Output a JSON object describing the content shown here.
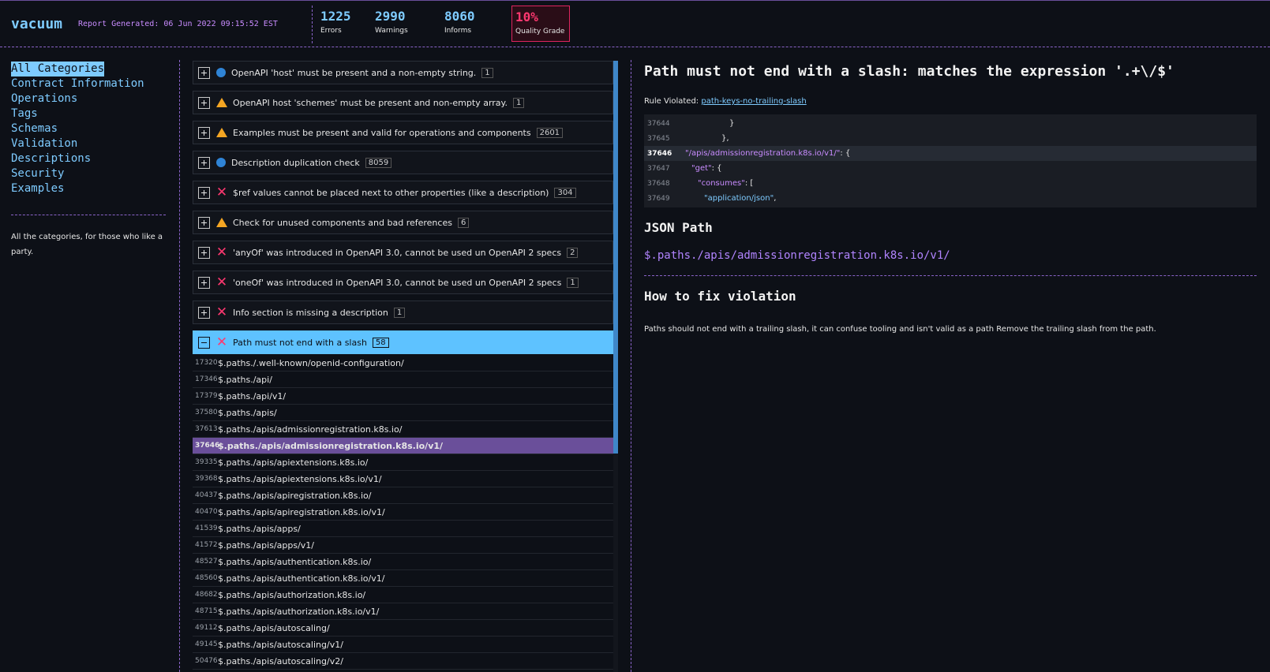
{
  "header": {
    "brand": "vacuum",
    "generated": "Report Generated: 06 Jun 2022 09:15:52 EST",
    "stats": [
      {
        "value": "1225",
        "label": "Errors"
      },
      {
        "value": "2990",
        "label": "Warnings"
      },
      {
        "value": "8060",
        "label": "Informs"
      }
    ],
    "grade": {
      "value": "10%",
      "label": "Quality Grade"
    }
  },
  "sidebar": {
    "items": [
      {
        "label": "All Categories"
      },
      {
        "label": "Contract Information"
      },
      {
        "label": "Operations"
      },
      {
        "label": "Tags"
      },
      {
        "label": "Schemas"
      },
      {
        "label": "Validation"
      },
      {
        "label": "Descriptions"
      },
      {
        "label": "Security"
      },
      {
        "label": "Examples"
      }
    ],
    "description": "All the categories, for those who like a party."
  },
  "rules": [
    {
      "icon": "info-icon",
      "text": "OpenAPI 'host' must be present and a non-empty string.",
      "count": "1"
    },
    {
      "icon": "warning-icon",
      "text": "OpenAPI host 'schemes' must be present and non-empty array.",
      "count": "1"
    },
    {
      "icon": "warning-icon",
      "text": "Examples must be present and valid for operations and components",
      "count": "2601"
    },
    {
      "icon": "info-icon",
      "text": "Description duplication check",
      "count": "8059"
    },
    {
      "icon": "error-icon",
      "text": "$ref values cannot be placed next to other properties (like a description)",
      "count": "304"
    },
    {
      "icon": "warning-icon",
      "text": "Check for unused components and bad references",
      "count": "6"
    },
    {
      "icon": "error-icon",
      "text": "'anyOf' was introduced in OpenAPI 3.0, cannot be used un OpenAPI 2 specs",
      "count": "2"
    },
    {
      "icon": "error-icon",
      "text": "'oneOf' was introduced in OpenAPI 3.0, cannot be used un OpenAPI 2 specs",
      "count": "1"
    },
    {
      "icon": "error-icon",
      "text": "Info section is missing a description",
      "count": "1"
    },
    {
      "icon": "error-icon",
      "text": "Path must not end with a slash",
      "count": "58"
    }
  ],
  "results": [
    {
      "line": "17320",
      "path": "$.paths./.well-known/openid-configuration/"
    },
    {
      "line": "17346",
      "path": "$.paths./api/"
    },
    {
      "line": "17379",
      "path": "$.paths./api/v1/"
    },
    {
      "line": "37580",
      "path": "$.paths./apis/"
    },
    {
      "line": "37613",
      "path": "$.paths./apis/admissionregistration.k8s.io/"
    },
    {
      "line": "37646",
      "path": "$.paths./apis/admissionregistration.k8s.io/v1/"
    },
    {
      "line": "39335",
      "path": "$.paths./apis/apiextensions.k8s.io/"
    },
    {
      "line": "39368",
      "path": "$.paths./apis/apiextensions.k8s.io/v1/"
    },
    {
      "line": "40437",
      "path": "$.paths./apis/apiregistration.k8s.io/"
    },
    {
      "line": "40470",
      "path": "$.paths./apis/apiregistration.k8s.io/v1/"
    },
    {
      "line": "41539",
      "path": "$.paths./apis/apps/"
    },
    {
      "line": "41572",
      "path": "$.paths./apis/apps/v1/"
    },
    {
      "line": "48527",
      "path": "$.paths./apis/authentication.k8s.io/"
    },
    {
      "line": "48560",
      "path": "$.paths./apis/authentication.k8s.io/v1/"
    },
    {
      "line": "48682",
      "path": "$.paths./apis/authorization.k8s.io/"
    },
    {
      "line": "48715",
      "path": "$.paths./apis/authorization.k8s.io/v1/"
    },
    {
      "line": "49112",
      "path": "$.paths./apis/autoscaling/"
    },
    {
      "line": "49145",
      "path": "$.paths./apis/autoscaling/v1/"
    },
    {
      "line": "50476",
      "path": "$.paths./apis/autoscaling/v2/"
    }
  ],
  "detail": {
    "title": "Path must not end with a slash: matches the expression '.+\\/$'",
    "rule_label": "Rule Violated:",
    "rule_link": "path-keys-no-trailing-slash",
    "code": [
      {
        "line": "37644",
        "a": "}",
        "b": "",
        "c": ""
      },
      {
        "line": "37645",
        "a": "},",
        "b": "",
        "c": ""
      },
      {
        "line": "37646",
        "a": "\"/apis/admissionregistration.k8s.io/v1/\"",
        "b": ":",
        "c": " {"
      },
      {
        "line": "37647",
        "a": "\"get\"",
        "b": ":",
        "c": " {"
      },
      {
        "line": "37648",
        "a": "\"consumes\"",
        "b": ":",
        "c": " ["
      },
      {
        "line": "37649",
        "a": "\"application/json\"",
        "b": ",",
        "c": ""
      }
    ],
    "json_path_heading": "JSON Path",
    "json_path": "$.paths./apis/admissionregistration.k8s.io/v1/",
    "fix_heading": "How to fix violation",
    "fix_text": "Paths should not end with a trailing slash, it can confuse tooling and isn't valid as a path Remove the trailing slash from the path."
  }
}
